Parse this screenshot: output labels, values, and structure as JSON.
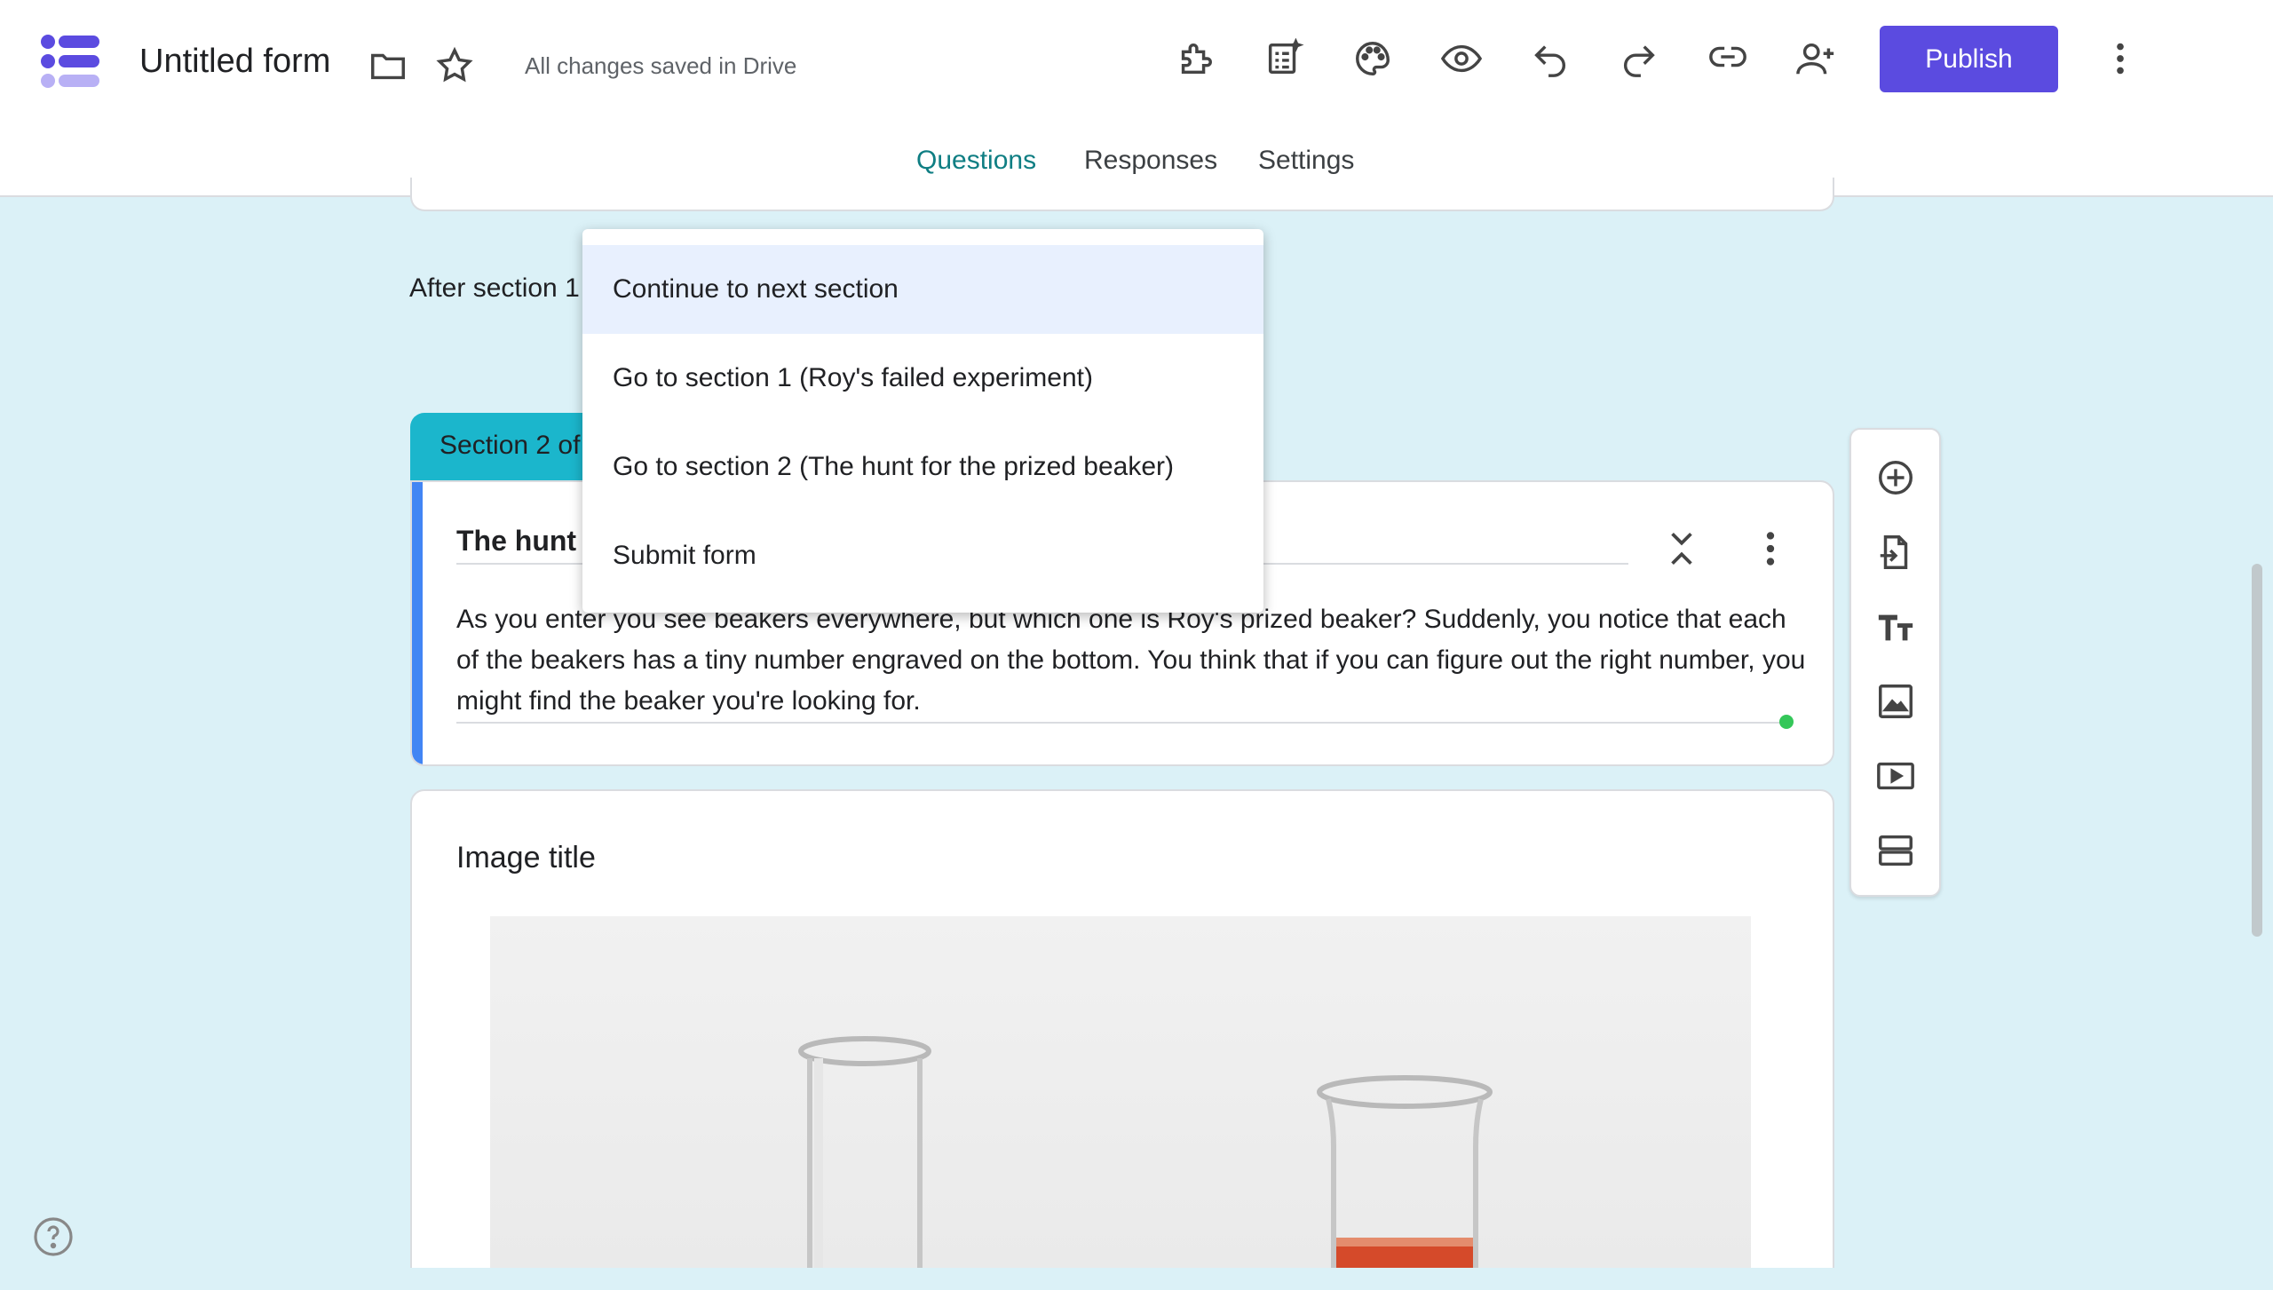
{
  "header": {
    "title": "Untitled form",
    "saved_status": "All changes saved in Drive",
    "publish_label": "Publish",
    "accent": "#5b4be0"
  },
  "tabs": [
    {
      "label": "Questions",
      "active": true
    },
    {
      "label": "Responses",
      "active": false
    },
    {
      "label": "Settings",
      "active": false
    }
  ],
  "after_section_label": "After section 1",
  "section": {
    "tab_label": "Section 2 of",
    "title": "The hunt",
    "description": "As you enter you see beakers everywhere, but which one is Roy's prized beaker? Suddenly, you notice that each of the beakers has a tiny number engraved on the bottom. You think that if you can figure out the right number, you might find the beaker you're looking for."
  },
  "image_item": {
    "title": "Image title"
  },
  "dropdown": {
    "options": [
      {
        "label": "Continue to next section",
        "selected": true
      },
      {
        "label": "Go to section 1 (Roy's failed experiment)",
        "selected": false
      },
      {
        "label": "Go to section 2 (The hunt for the prized beaker)",
        "selected": false
      },
      {
        "label": "Submit form",
        "selected": false
      }
    ]
  },
  "toolbar_icons": [
    "add-question-icon",
    "import-questions-icon",
    "add-title-icon",
    "add-image-icon",
    "add-video-icon",
    "add-section-icon"
  ],
  "colors": {
    "background": "#dbf1f7",
    "section_tab": "#1bb6cc",
    "active_tab": "#0f7e83",
    "section_bar": "#4285f4"
  }
}
